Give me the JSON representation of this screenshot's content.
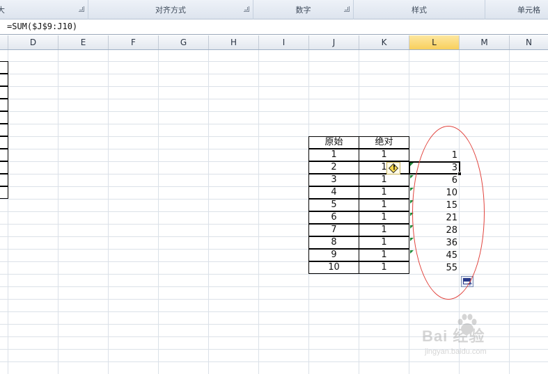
{
  "ribbon": {
    "groups": [
      {
        "label": "大",
        "has_launcher": true
      },
      {
        "label": "对齐方式",
        "has_launcher": true
      },
      {
        "label": "数字",
        "has_launcher": true
      },
      {
        "label": "样式",
        "has_launcher": false
      },
      {
        "label": "单元格",
        "has_launcher": false
      }
    ]
  },
  "formula_bar": {
    "formula": "=SUM($J$9:J10)"
  },
  "columns": [
    "D",
    "E",
    "F",
    "G",
    "H",
    "I",
    "J",
    "K",
    "L",
    "M",
    "N"
  ],
  "active_column": "L",
  "table": {
    "headers": [
      "原始",
      "绝对"
    ],
    "rows": [
      {
        "original": "1",
        "absolute": "1"
      },
      {
        "original": "2",
        "absolute": "1"
      },
      {
        "original": "3",
        "absolute": "1"
      },
      {
        "original": "4",
        "absolute": "1"
      },
      {
        "original": "5",
        "absolute": "1"
      },
      {
        "original": "6",
        "absolute": "1"
      },
      {
        "original": "7",
        "absolute": "1"
      },
      {
        "original": "8",
        "absolute": "1"
      },
      {
        "original": "9",
        "absolute": "1"
      },
      {
        "original": "10",
        "absolute": "1"
      }
    ]
  },
  "cumulative": [
    "1",
    "3",
    "6",
    "10",
    "15",
    "21",
    "28",
    "36",
    "45",
    "55"
  ],
  "warning_tag": {
    "symbol": "!"
  },
  "watermark": {
    "brand": "Bai 经验",
    "url": "jingyan.baidu.com"
  },
  "colors": {
    "annotation": "#e0403a",
    "active_header": "#f8cf5c",
    "error_indicator": "#1f8a3a"
  }
}
